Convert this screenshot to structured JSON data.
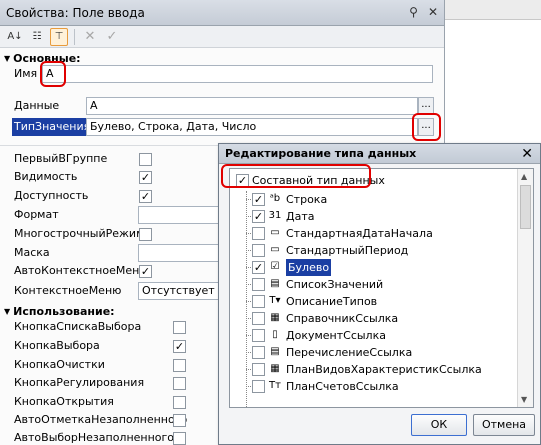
{
  "panel": {
    "title": "Свойства: Поле ввода",
    "title_icons": [
      "pin-icon",
      "close-icon"
    ],
    "toolbar": [
      "sort-alpha-icon",
      "categorize-icon",
      "filter-icon",
      "cancel-icon",
      "check-icon"
    ]
  },
  "sections": {
    "basic": "Основные:",
    "usage": "Использование:"
  },
  "properties": {
    "name_label": "Имя",
    "name_value": "А",
    "data_label": "Данные",
    "data_value": "А",
    "type_label": "ТипЗначения",
    "type_value": "Булево, Строка, Дата, Число",
    "dots": "...",
    "first_in_group": "ПервыйВГруппе",
    "visibility": "Видимость",
    "availability": "Доступность",
    "format": "Формат",
    "multiline": "МногострочныйРежим",
    "mask": "Маска",
    "auto_context_menu": "АвтоКонтекстноеМеню",
    "context_menu": "КонтекстноеМеню",
    "context_menu_value": "Отсутствует"
  },
  "usage": {
    "choice_list_button": "КнопкаСпискаВыбора",
    "choice_button": "КнопкаВыбора",
    "clear_button": "КнопкаОчистки",
    "adjust_button": "КнопкаРегулирования",
    "open_button": "КнопкаОткрытия",
    "auto_mark_unfilled": "АвтоОтметкаНезаполненного",
    "auto_choice_unfilled": "АвтоВыборНезаполненного"
  },
  "dialog": {
    "title": "Редактирование типа данных",
    "composite_label": "Составной тип данных",
    "types": [
      {
        "label": "Строка",
        "checked": true,
        "icon": "string-type-icon"
      },
      {
        "label": "Дата",
        "checked": true,
        "icon": "date-type-icon"
      },
      {
        "label": "СтандартнаяДатаНачала",
        "checked": false,
        "icon": "std-date-icon"
      },
      {
        "label": "СтандартныйПериод",
        "checked": false,
        "icon": "std-period-icon"
      },
      {
        "label": "Булево",
        "checked": true,
        "icon": "boolean-type-icon",
        "selected": true
      },
      {
        "label": "СписокЗначений",
        "checked": false,
        "icon": "value-list-icon"
      },
      {
        "label": "ОписаниеТипов",
        "checked": false,
        "icon": "type-description-icon"
      },
      {
        "label": "СправочникСсылка",
        "checked": false,
        "icon": "catalog-ref-icon"
      },
      {
        "label": "ДокументСсылка",
        "checked": false,
        "icon": "document-ref-icon"
      },
      {
        "label": "ПеречислениеСсылка",
        "checked": false,
        "icon": "enum-ref-icon"
      },
      {
        "label": "ПланВидовХарактеристикСсылка",
        "checked": false,
        "icon": "chart-of-characteristics-icon"
      },
      {
        "label": "ПланСчетовСсылка",
        "checked": false,
        "icon": "chart-of-accounts-icon"
      }
    ],
    "ok_label": "ОК",
    "cancel_label": "Отмена"
  }
}
